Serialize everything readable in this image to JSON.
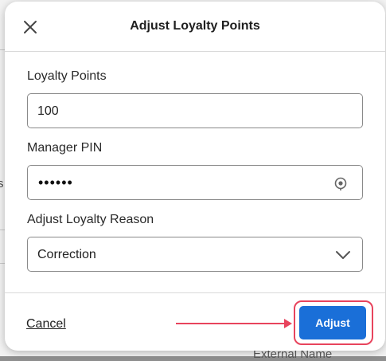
{
  "modal": {
    "title": "Adjust Loyalty Points",
    "close_icon": "close-icon"
  },
  "fields": {
    "points": {
      "label": "Loyalty Points",
      "value": "100"
    },
    "pin": {
      "label": "Manager PIN",
      "value": "••••••",
      "icon": "eye-icon"
    },
    "reason": {
      "label": "Adjust Loyalty Reason",
      "value": "Correction",
      "icon": "chevron-down-icon"
    }
  },
  "footer": {
    "cancel_label": "Cancel",
    "adjust_label": "Adjust"
  },
  "background": {
    "edge_text": "s",
    "bottom_text": "External Name"
  },
  "colors": {
    "primary_button": "#1a6fd8",
    "highlight": "#e8445d"
  }
}
